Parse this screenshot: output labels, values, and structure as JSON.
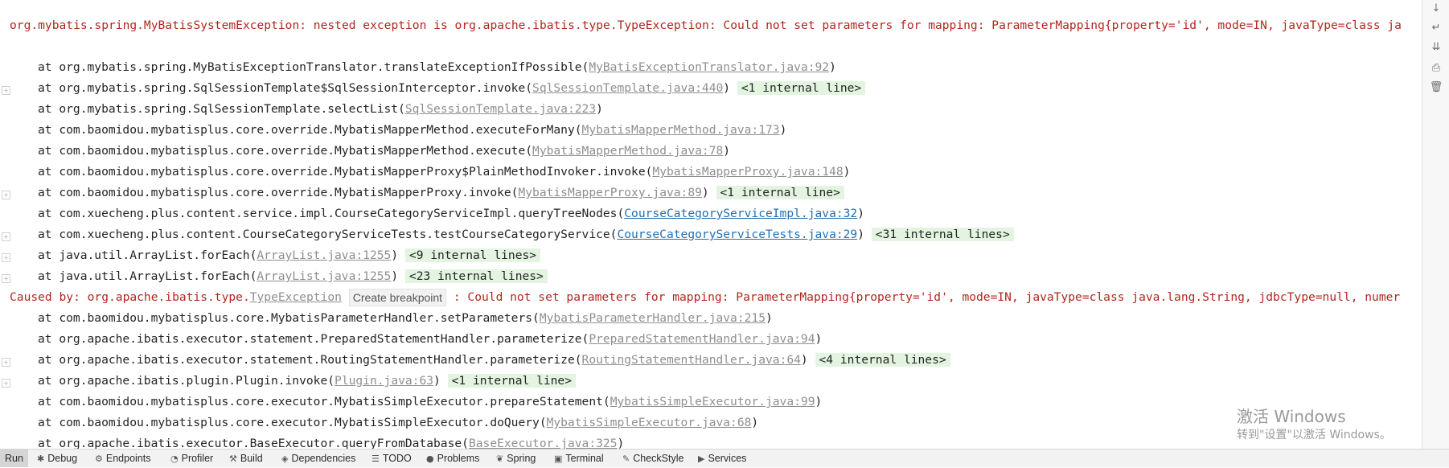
{
  "console": {
    "header_line": "org.mybatis.spring.MyBatisSystemException: nested exception is org.apache.ibatis.type.TypeException: Could not set parameters for mapping: ParameterMapping{property='id', mode=IN, javaType=class ja",
    "frames": [
      {
        "prefix": "at org.mybatis.spring.MyBatisExceptionTranslator.translateExceptionIfPossible(",
        "link": "MyBatisExceptionTranslator.java:92",
        "suffix": ")",
        "internal": ""
      },
      {
        "prefix": "at org.mybatis.spring.SqlSessionTemplate$SqlSessionInterceptor.invoke(",
        "link": "SqlSessionTemplate.java:440",
        "suffix": ")",
        "internal": "<1 internal line>"
      },
      {
        "prefix": "at org.mybatis.spring.SqlSessionTemplate.selectList(",
        "link": "SqlSessionTemplate.java:223",
        "suffix": ")",
        "internal": ""
      },
      {
        "prefix": "at com.baomidou.mybatisplus.core.override.MybatisMapperMethod.executeForMany(",
        "link": "MybatisMapperMethod.java:173",
        "suffix": ")",
        "internal": ""
      },
      {
        "prefix": "at com.baomidou.mybatisplus.core.override.MybatisMapperMethod.execute(",
        "link": "MybatisMapperMethod.java:78",
        "suffix": ")",
        "internal": ""
      },
      {
        "prefix": "at com.baomidou.mybatisplus.core.override.MybatisMapperProxy$PlainMethodInvoker.invoke(",
        "link": "MybatisMapperProxy.java:148",
        "suffix": ")",
        "internal": ""
      },
      {
        "prefix": "at com.baomidou.mybatisplus.core.override.MybatisMapperProxy.invoke(",
        "link": "MybatisMapperProxy.java:89",
        "suffix": ")",
        "internal": "<1 internal line>"
      },
      {
        "prefix": "at com.xuecheng.plus.content.service.impl.CourseCategoryServiceImpl.queryTreeNodes(",
        "link": "CourseCategoryServiceImpl.java:32",
        "suffix": ")",
        "internal": ""
      },
      {
        "prefix": "at com.xuecheng.plus.content.CourseCategoryServiceTests.testCourseCategoryService(",
        "link": "CourseCategoryServiceTests.java:29",
        "suffix": ")",
        "internal": "<31 internal lines>"
      },
      {
        "prefix": "at java.util.ArrayList.forEach(",
        "link": "ArrayList.java:1255",
        "suffix": ")",
        "internal": "<9 internal lines>"
      },
      {
        "prefix": "at java.util.ArrayList.forEach(",
        "link": "ArrayList.java:1255",
        "suffix": ")",
        "internal": "<23 internal lines>"
      }
    ],
    "caused_by": {
      "prefix": "Caused by: org.apache.ibatis.type.",
      "link": "TypeException",
      "tooltip": "Create breakpoint",
      "suffix": " : Could not set parameters for mapping: ParameterMapping{property='id', mode=IN, javaType=class java.lang.String, jdbcType=null, numer"
    },
    "frames2": [
      {
        "prefix": "at com.baomidou.mybatisplus.core.MybatisParameterHandler.setParameters(",
        "link": "MybatisParameterHandler.java:215",
        "suffix": ")",
        "internal": ""
      },
      {
        "prefix": "at org.apache.ibatis.executor.statement.PreparedStatementHandler.parameterize(",
        "link": "PreparedStatementHandler.java:94",
        "suffix": ")",
        "internal": ""
      },
      {
        "prefix": "at org.apache.ibatis.executor.statement.RoutingStatementHandler.parameterize(",
        "link": "RoutingStatementHandler.java:64",
        "suffix": ")",
        "internal": "<4 internal lines>"
      },
      {
        "prefix": "at org.apache.ibatis.plugin.Plugin.invoke(",
        "link": "Plugin.java:63",
        "suffix": ")",
        "internal": "<1 internal line>"
      },
      {
        "prefix": "at com.baomidou.mybatisplus.core.executor.MybatisSimpleExecutor.prepareStatement(",
        "link": "MybatisSimpleExecutor.java:99",
        "suffix": ")",
        "internal": ""
      },
      {
        "prefix": "at com.baomidou.mybatisplus.core.executor.MybatisSimpleExecutor.doQuery(",
        "link": "MybatisSimpleExecutor.java:68",
        "suffix": ")",
        "internal": ""
      },
      {
        "prefix": "at org.apache.ibatis.executor.BaseExecutor.queryFromDatabase(",
        "link": "BaseExecutor.java:325",
        "suffix": ")",
        "internal": ""
      }
    ]
  },
  "watermark": {
    "title": "激活 Windows",
    "subtitle": "转到\"设置\"以激活 Windows。"
  },
  "bottom_tabs": [
    {
      "label": "Run",
      "icon": ""
    },
    {
      "label": "Debug",
      "icon": "✱"
    },
    {
      "label": "Endpoints",
      "icon": "⚙"
    },
    {
      "label": "Profiler",
      "icon": "◔"
    },
    {
      "label": "Build",
      "icon": "⚒"
    },
    {
      "label": "Dependencies",
      "icon": "◈"
    },
    {
      "label": "TODO",
      "icon": "☰"
    },
    {
      "label": "Problems",
      "icon": "●"
    },
    {
      "label": "Spring",
      "icon": "❦"
    },
    {
      "label": "Terminal",
      "icon": "▣"
    },
    {
      "label": "CheckStyle",
      "icon": "✎"
    },
    {
      "label": "Services",
      "icon": "▶"
    }
  ],
  "right_tools": [
    "arrow-down-icon",
    "soft-wrap-icon",
    "scroll-to-end-icon",
    "print-icon",
    "trash-icon"
  ]
}
